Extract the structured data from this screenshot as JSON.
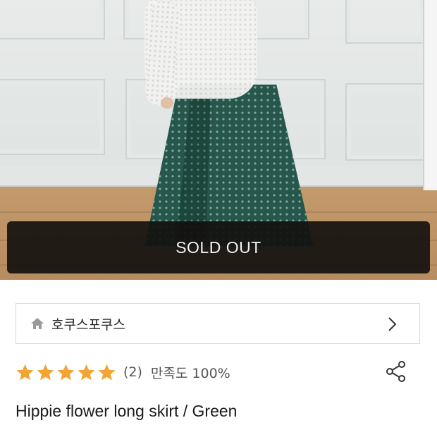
{
  "product": {
    "status_overlay": "SOLD OUT",
    "brand": "호쿠스포쿠스",
    "rating": {
      "stars": 5,
      "max_stars": 5,
      "review_count": "(2)",
      "satisfaction": "만족도 100%"
    },
    "title": "Hippie flower long skirt / Green"
  },
  "icons": {
    "brand_icon": "home-icon",
    "brand_chevron": "chevron-right-icon",
    "star": "star-icon",
    "share": "share-icon"
  },
  "colors": {
    "star": "#f2a533",
    "overlay": "#14110f",
    "overlay_text": "#f2f2f2",
    "border": "#d9d9d9"
  }
}
